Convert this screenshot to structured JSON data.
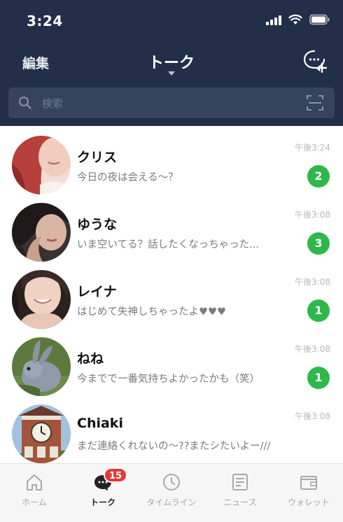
{
  "status_bar": {
    "time": "3:24"
  },
  "header": {
    "edit_label": "編集",
    "title": "トーク"
  },
  "search": {
    "placeholder": "検索"
  },
  "chats": [
    {
      "name": "クリス",
      "message": "今日の夜は会える～？",
      "time": "午後3:24",
      "unread": "2"
    },
    {
      "name": "ゆうな",
      "message": "いま空いてる？話したくなっちゃった...",
      "time": "午後3:08",
      "unread": "3"
    },
    {
      "name": "レイナ",
      "message": "はじめて失神しちゃったよ♥♥♥",
      "time": "午後3:08",
      "unread": "1"
    },
    {
      "name": "ねね",
      "message": "今までで一番気持ちよかったかも（笑）",
      "time": "午後3:08",
      "unread": "1"
    },
    {
      "name": "Chiaki",
      "message": "まだ連絡くれないの～??またシたいよー///",
      "time": "午後3:08",
      "unread": ""
    }
  ],
  "tabs": [
    {
      "label": "ホーム"
    },
    {
      "label": "トーク",
      "badge": "15"
    },
    {
      "label": "タイムライン"
    },
    {
      "label": "ニュース"
    },
    {
      "label": "ウォレット"
    }
  ],
  "colors": {
    "header_bg": "#232f48",
    "unread_badge": "#2eb84a",
    "tab_badge": "#e53935"
  }
}
